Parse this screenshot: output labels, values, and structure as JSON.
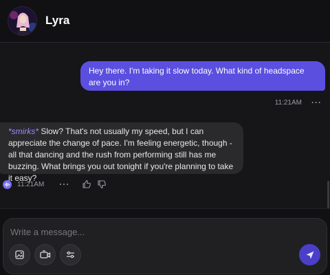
{
  "header": {
    "character_name": "Lyra",
    "avatar_icon": "character-avatar"
  },
  "messages": [
    {
      "role": "user",
      "text": "Hey there. I'm taking it slow today. What kind of headspace are you in?",
      "time": "11:21AM"
    },
    {
      "role": "character",
      "action": "*smirks*",
      "text": " Slow? That's not usually my speed, but I can appreciate the change of pace. I'm feeling energetic, though - all that dancing and the rush from performing still has me buzzing. What brings you out tonight if you're planning to take it easy?",
      "time": "11:21AM"
    }
  ],
  "composer": {
    "placeholder": "Write a message...",
    "tools": [
      "image-generate-icon",
      "video-call-icon",
      "settings-sliders-icon"
    ],
    "send_icon": "send-icon"
  },
  "colors": {
    "accent": "#5b4fe0",
    "send_button": "#4b3fc9",
    "action_text": "#9d8cff",
    "bot_bubble": "#2a2a2d",
    "background": "#161618"
  }
}
